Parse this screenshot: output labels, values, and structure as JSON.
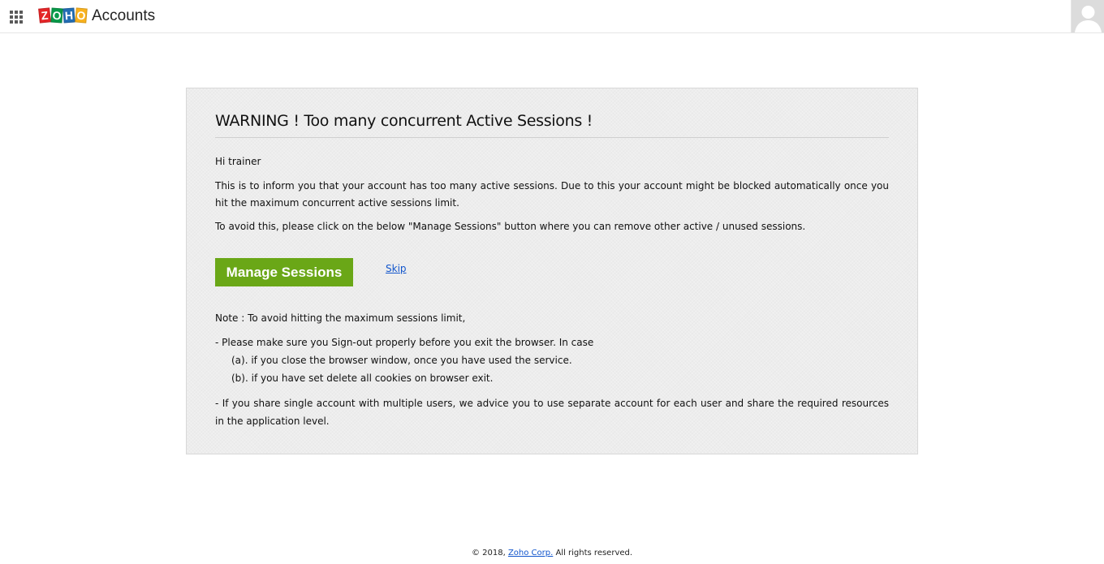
{
  "header": {
    "apps_icon": "grid-icon",
    "logo_letters": [
      "Z",
      "O",
      "H",
      "O"
    ],
    "logo_colors": [
      "#e42527",
      "#089949",
      "#226db4",
      "#f9b21d"
    ],
    "app_name": "Accounts",
    "avatar_icon": "user-avatar-icon"
  },
  "warning": {
    "title": "WARNING ! Too many concurrent Active Sessions !",
    "greeting": "Hi trainer",
    "info": "This is to inform you that your account has too many active sessions. Due to this your account might be blocked automatically once you hit the maximum concurrent active sessions limit.",
    "instruction": "To avoid this, please click on the below \"Manage Sessions\" button where you can remove other active / unused sessions.",
    "manage_button": "Manage Sessions",
    "skip_link": "Skip",
    "note_heading": "Note : To avoid hitting the maximum sessions limit,",
    "note_signout": "- Please make sure you Sign-out properly before you exit the browser. In case",
    "note_case_a": "(a). if you close the browser window, once you have used the service.",
    "note_case_b": "(b). if you have set delete all cookies on browser exit.",
    "note_share": "- If you share single account with multiple users, we advice you to use separate account for each user and share the required resources in the application level."
  },
  "footer": {
    "copyright_prefix": "© 2018,",
    "company_link": "Zoho Corp.",
    "copyright_suffix": "All rights reserved."
  },
  "colors": {
    "button_bg": "#6aa717",
    "link": "#1155cc",
    "card_bg": "#ededed"
  }
}
